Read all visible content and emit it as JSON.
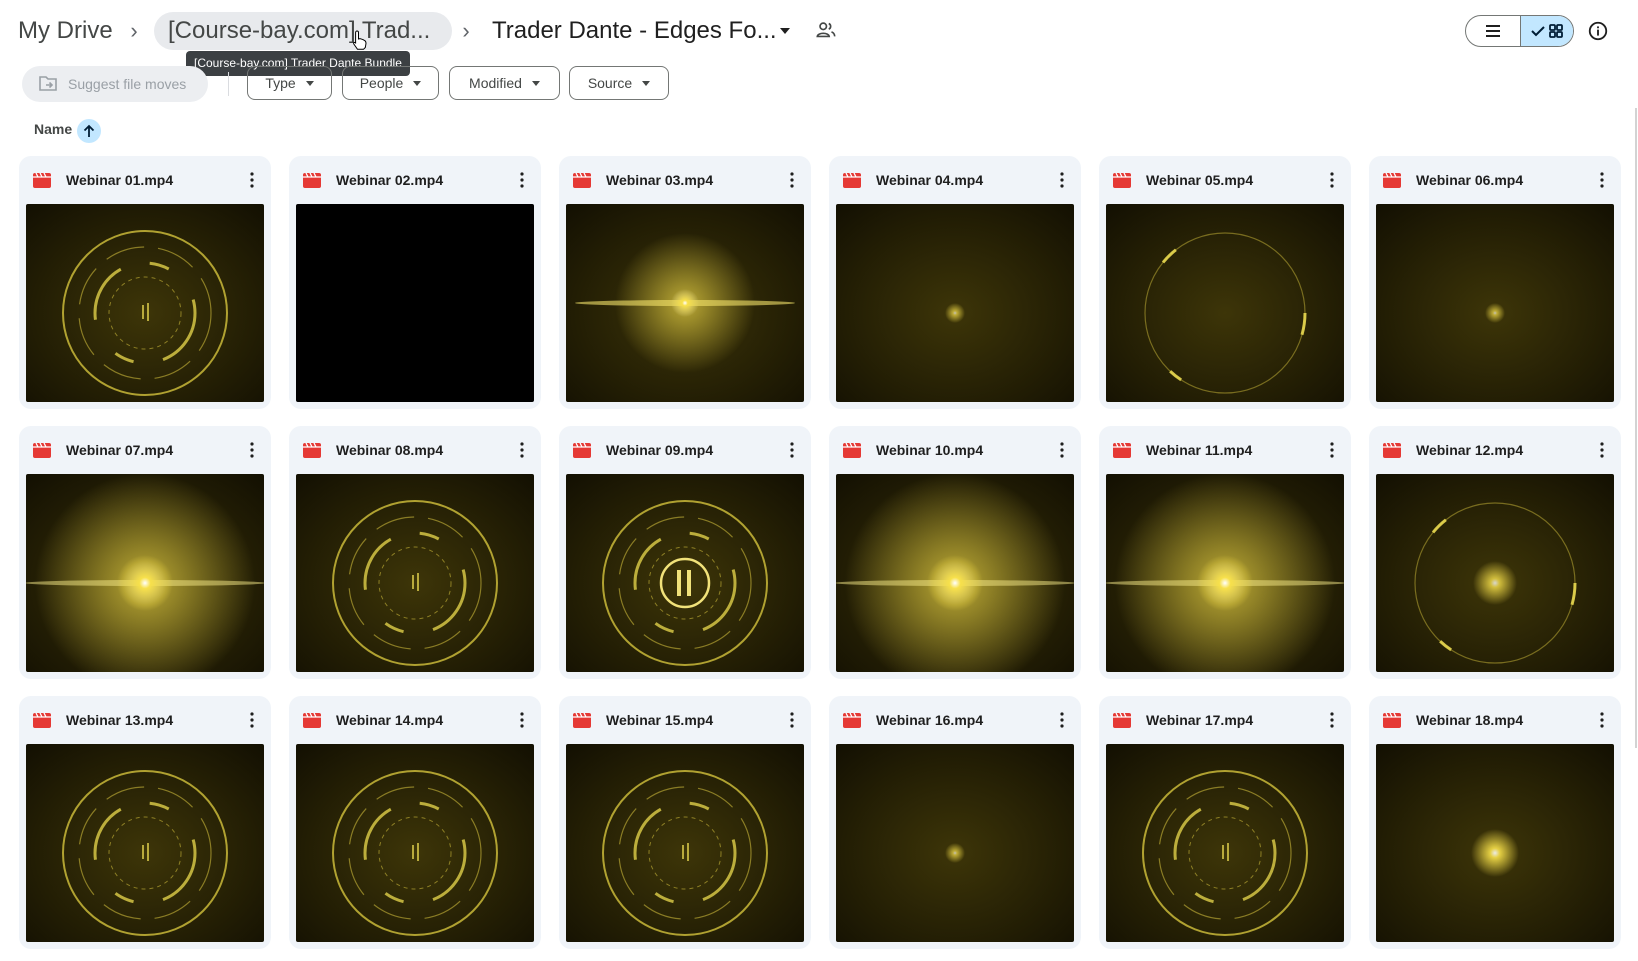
{
  "breadcrumb": {
    "root": "My Drive",
    "parent": "[Course-bay.com] Trad...",
    "current": "Trader Dante - Edges Fo..."
  },
  "tooltip": "[Course-bay.com] Trader Dante Bundle",
  "toolbar": {
    "suggest_label": "Suggest file moves",
    "filters": [
      "Type",
      "People",
      "Modified",
      "Source"
    ]
  },
  "sort": {
    "label": "Name",
    "direction": "ascending"
  },
  "colors": {
    "accent": "#c2e7ff",
    "video_icon": "#e53935",
    "thumb_glow": "#f7e04a"
  },
  "files": [
    {
      "name": "Webinar 01.mp4",
      "thumb": "rings"
    },
    {
      "name": "Webinar 02.mp4",
      "thumb": "black"
    },
    {
      "name": "Webinar 03.mp4",
      "thumb": "flare"
    },
    {
      "name": "Webinar 04.mp4",
      "thumb": "dot"
    },
    {
      "name": "Webinar 05.mp4",
      "thumb": "ring-sparse"
    },
    {
      "name": "Webinar 06.mp4",
      "thumb": "dot"
    },
    {
      "name": "Webinar 07.mp4",
      "thumb": "glow"
    },
    {
      "name": "Webinar 08.mp4",
      "thumb": "rings"
    },
    {
      "name": "Webinar 09.mp4",
      "thumb": "logo"
    },
    {
      "name": "Webinar 10.mp4",
      "thumb": "glow"
    },
    {
      "name": "Webinar 11.mp4",
      "thumb": "glow"
    },
    {
      "name": "Webinar 12.mp4",
      "thumb": "ring-sparse-dot"
    },
    {
      "name": "Webinar 13.mp4",
      "thumb": "rings"
    },
    {
      "name": "Webinar 14.mp4",
      "thumb": "rings"
    },
    {
      "name": "Webinar 15.mp4",
      "thumb": "rings"
    },
    {
      "name": "Webinar 16.mp4",
      "thumb": "dot"
    },
    {
      "name": "Webinar 17.mp4",
      "thumb": "rings"
    },
    {
      "name": "Webinar 18.mp4",
      "thumb": "dot-bright"
    }
  ]
}
